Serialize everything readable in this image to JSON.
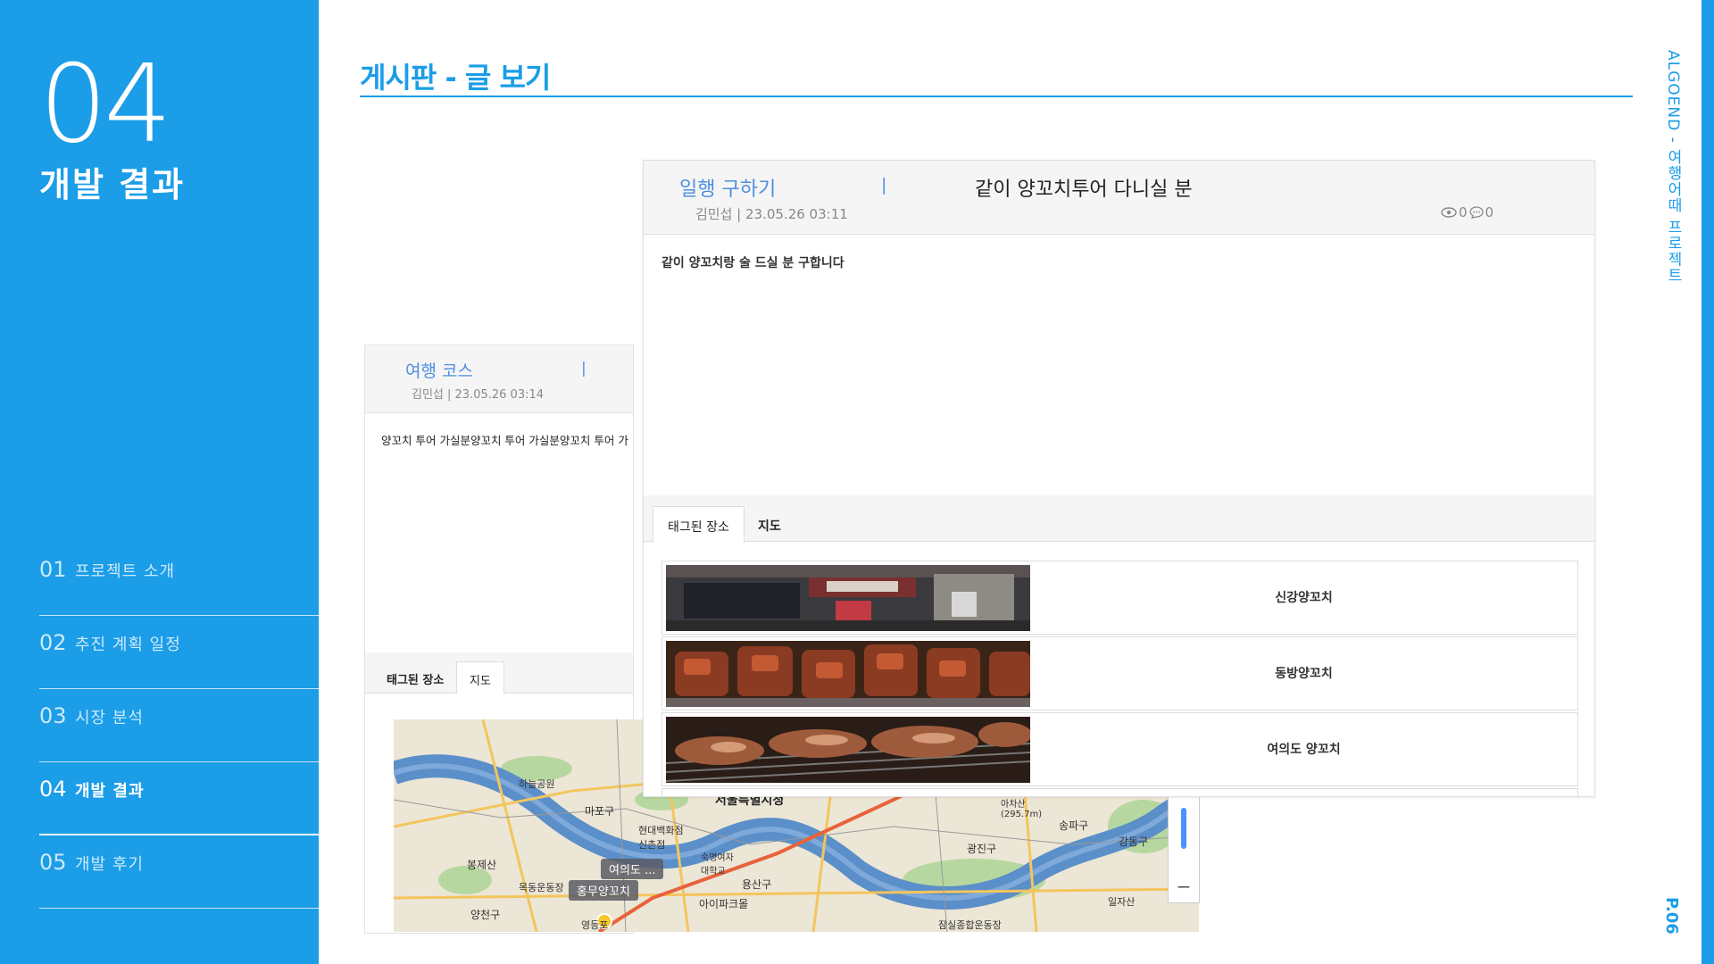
{
  "sidebar": {
    "section_number": "04",
    "section_title": "개발 결과",
    "nav": [
      {
        "num": "01",
        "label": "프로젝트 소개"
      },
      {
        "num": "02",
        "label": "추진 계획 일정"
      },
      {
        "num": "03",
        "label": "시장 분석"
      },
      {
        "num": "04",
        "label": "개발 결과"
      },
      {
        "num": "05",
        "label": "개발 후기"
      }
    ]
  },
  "header": {
    "title": "게시판 - 글 보기"
  },
  "side_text": {
    "project": "ALGOEND - 여행어때 프로젝트",
    "page": "P.06"
  },
  "back_post": {
    "category": "여행 코스",
    "separator": "|",
    "meta": "김민섭 | 23.05.26 03:14",
    "body": "양꼬치 투어 가실분양꼬치 투어 가실분양꼬치 투어 가",
    "tabs": [
      "태그된 장소",
      "지도"
    ]
  },
  "front_post": {
    "category": "일행 구하기",
    "separator": "|",
    "title": "같이 양꼬치투어 다니실 분",
    "meta": "김민섭 | 23.05.26 03:11",
    "views": "0",
    "comments": "0",
    "body": "같이 양꼬치랑 술 드실 분 구합니다",
    "tabs": [
      "태그된 장소",
      "지도"
    ],
    "places": [
      {
        "name": "신강양꼬치"
      },
      {
        "name": "동방양꼬치"
      },
      {
        "name": "여의도 양꼬치"
      }
    ]
  },
  "map": {
    "labels": [
      {
        "text": "서울특별시청"
      },
      {
        "text": "마포구"
      },
      {
        "text": "현대백화점 신촌점"
      },
      {
        "text": "숙명여자대학교"
      },
      {
        "text": "용산구"
      },
      {
        "text": "아이파크몰"
      },
      {
        "text": "광진구"
      },
      {
        "text": "강동구"
      },
      {
        "text": "송파구"
      },
      {
        "text": "봉제산"
      },
      {
        "text": "양천구"
      },
      {
        "text": "목동운동장"
      },
      {
        "text": "하늘공원"
      },
      {
        "text": "영등포"
      },
      {
        "text": "아차산 (295.7m)"
      },
      {
        "text": "일자산"
      },
      {
        "text": "잠실종합운동장"
      }
    ],
    "pins": [
      {
        "text": "여의도 ..."
      },
      {
        "text": "홍무양꼬치"
      }
    ],
    "zoom_minus": "−",
    "colors": {
      "water": "#5b8fc9",
      "land": "#ece6d6",
      "park": "#b7d7a0",
      "road": "#f3c55c",
      "route": "#e8623a"
    }
  }
}
